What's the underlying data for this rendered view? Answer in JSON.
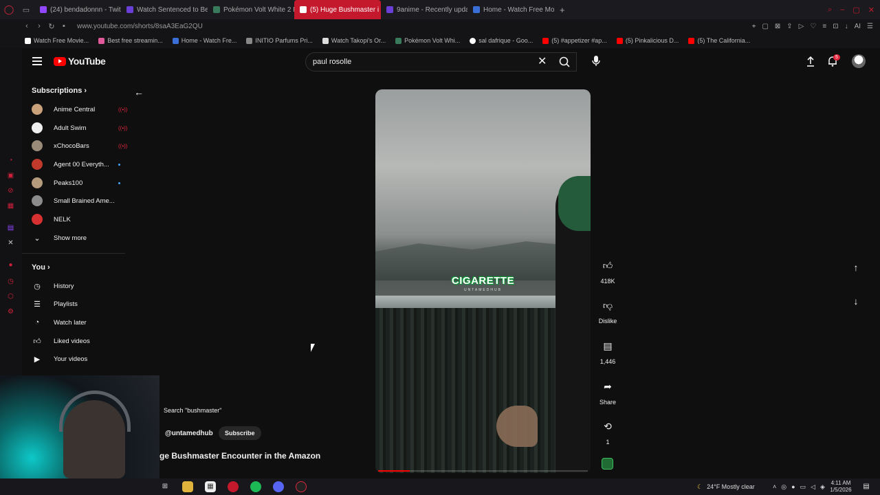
{
  "browser": {
    "tabs": [
      {
        "label": "(24) bendadonnn - Twitch",
        "color": "#9146ff"
      },
      {
        "label": "Watch Sentenced to Be a",
        "color": "#6a3fd8"
      },
      {
        "label": "Pokémon Volt White 2 Re",
        "color": "#3a7a5c"
      },
      {
        "label": "(5) Huge Bushmaster i",
        "color": "#ff0000"
      },
      {
        "label": "9anime - Recently updat",
        "color": "#6a3fd8"
      },
      {
        "label": "Home - Watch Free Movie",
        "color": "#3b6fd8"
      }
    ],
    "url": "www.youtube.com/shorts/8saA3EaG2QU",
    "bookmarks": [
      {
        "label": "Watch Free Movie...",
        "color": "#ffffff"
      },
      {
        "label": "Best free streamin...",
        "color": "#e05a9b"
      },
      {
        "label": "Home - Watch Fre...",
        "color": "#3b6fd8"
      },
      {
        "label": "INITIO Parfums Pri...",
        "color": "#888888"
      },
      {
        "label": "Watch Takopi's Or...",
        "color": "#dddddd"
      },
      {
        "label": "Pokémon Volt Whi...",
        "color": "#3a7a5c"
      },
      {
        "label": "sal dafrique - Goo...",
        "color": "#ffffff"
      },
      {
        "label": "(5) #appetizer #ap...",
        "color": "#ff0000"
      },
      {
        "label": "(5) Pinkalicious D...",
        "color": "#ff0000"
      },
      {
        "label": "(5) The California...",
        "color": "#ff0000"
      }
    ]
  },
  "youtube": {
    "logo_text": "YouTube",
    "search_value": "paul rosolle",
    "notification_count": "5"
  },
  "sidebar": {
    "subscriptions_title": "Subscriptions",
    "subscriptions": [
      {
        "name": "Anime Central",
        "status": "live",
        "color": "#c9a27c"
      },
      {
        "name": "Adult Swim",
        "status": "live",
        "color": "#eeeeee"
      },
      {
        "name": "xChocoBars",
        "status": "live",
        "color": "#9a8a7a"
      },
      {
        "name": "Agent 00 Everyth...",
        "status": "new",
        "color": "#c0392b"
      },
      {
        "name": "Peaks100",
        "status": "new",
        "color": "#b59b7d"
      },
      {
        "name": "Small Brained Ame...",
        "status": "none",
        "color": "#8c8c8c"
      },
      {
        "name": "NELK",
        "status": "none",
        "color": "#d63031"
      }
    ],
    "show_more": "Show more",
    "you_title": "You",
    "you_items": [
      {
        "label": "History",
        "icon": "history-icon"
      },
      {
        "label": "Playlists",
        "icon": "playlists-icon"
      },
      {
        "label": "Watch later",
        "icon": "watch-later-icon"
      },
      {
        "label": "Liked videos",
        "icon": "like-icon"
      },
      {
        "label": "Your videos",
        "icon": "your-videos-icon"
      }
    ]
  },
  "short": {
    "overlay_title": "CIGARETTE",
    "overlay_subtitle": "UNTAMEDHUB",
    "progress": 0.15,
    "actions": {
      "likes": "418K",
      "dislike": "Dislike",
      "comments": "1,446",
      "share": "Share",
      "remix": "1"
    },
    "search_chip": "Search \"bushmaster\"",
    "channel_handle": "@untamedhub",
    "subscribe_label": "Subscribe",
    "title": "ge Bushmaster Encounter in the Amazon"
  },
  "taskbar": {
    "weather": "24°F  Mostly clear",
    "time": "4:11 AM",
    "date": "1/5/2026"
  }
}
